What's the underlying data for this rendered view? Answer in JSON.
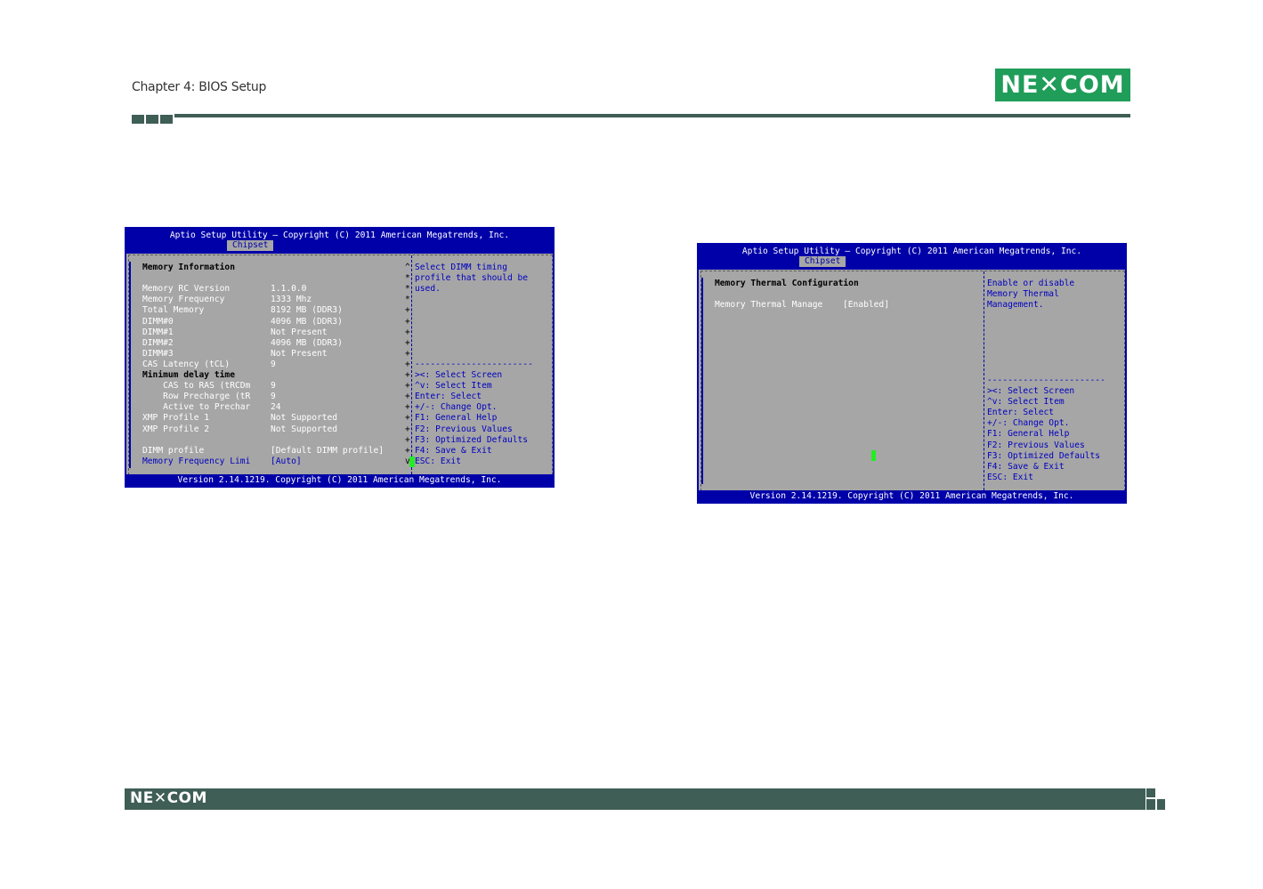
{
  "page": {
    "chapter_title": "Chapter 4: BIOS Setup",
    "logo_text": "NE✕COM",
    "footer_logo_text": "NE✕COM"
  },
  "bios_left": {
    "title": "Aptio Setup Utility – Copyright (C) 2011 American Megatrends, Inc.",
    "tab": "Chipset",
    "footer": "Version 2.14.1219. Copyright (C) 2011 American Megatrends, Inc.",
    "rows": [
      {
        "label": "Memory Information",
        "value": "",
        "style": "black"
      },
      {
        "label": "",
        "value": "",
        "style": "white"
      },
      {
        "label": "Memory RC Version",
        "value": "1.1.0.0",
        "style": "white"
      },
      {
        "label": "Memory Frequency",
        "value": "1333 Mhz",
        "style": "white"
      },
      {
        "label": "Total Memory",
        "value": "8192 MB (DDR3)",
        "style": "white"
      },
      {
        "label": "DIMM#0",
        "value": "4096 MB (DDR3)",
        "style": "white"
      },
      {
        "label": "DIMM#1",
        "value": "Not Present",
        "style": "white"
      },
      {
        "label": "DIMM#2",
        "value": "4096 MB (DDR3)",
        "style": "white"
      },
      {
        "label": "DIMM#3",
        "value": "Not Present",
        "style": "white"
      },
      {
        "label": "CAS Latency (tCL)",
        "value": "9",
        "style": "white"
      },
      {
        "label": "Minimum delay time",
        "value": "",
        "style": "black"
      },
      {
        "label": "    CAS to RAS (tRCDm",
        "value": "9",
        "style": "white"
      },
      {
        "label": "    Row Precharge (tR",
        "value": "9",
        "style": "white"
      },
      {
        "label": "    Active to Prechar",
        "value": "24",
        "style": "white"
      },
      {
        "label": "XMP Profile 1",
        "value": "Not Supported",
        "style": "white"
      },
      {
        "label": "XMP Profile 2",
        "value": "Not Supported",
        "style": "white"
      },
      {
        "label": "",
        "value": "",
        "style": "white"
      },
      {
        "label": "DIMM profile",
        "value": "[Default DIMM profile]",
        "style": "white"
      },
      {
        "label": "Memory Frequency Limi",
        "value": "[Auto]",
        "style": "blue"
      }
    ],
    "scroll_marks": [
      "^",
      "*",
      "*",
      "*",
      "+",
      "+",
      "+",
      "+",
      "+",
      "+",
      "+",
      "+",
      "+",
      "+",
      "+",
      "+",
      "+",
      "+",
      "v"
    ],
    "help_lines": [
      "Select DIMM timing",
      "profile that should be",
      "used.",
      "",
      "",
      "",
      "",
      "",
      "",
      "-----------------------",
      "><: Select Screen",
      "^v: Select Item",
      "Enter: Select",
      "+/-: Change Opt.",
      "F1: General Help",
      "F2: Previous Values",
      "F3: Optimized Defaults",
      "F4: Save & Exit",
      "ESC: Exit"
    ]
  },
  "bios_right": {
    "title": "Aptio Setup Utility – Copyright (C) 2011 American Megatrends, Inc.",
    "tab": "Chipset",
    "footer": "Version 2.14.1219. Copyright (C) 2011 American Megatrends, Inc.",
    "rows": [
      {
        "label": "Memory Thermal Configuration",
        "value": "",
        "style": "black"
      },
      {
        "label": "",
        "value": "",
        "style": "white"
      },
      {
        "label": "Memory Thermal Manage",
        "value": "[Enabled]",
        "style": "white"
      }
    ],
    "help_lines": [
      "Enable or disable",
      "Memory Thermal",
      "Management.",
      "",
      "",
      "",
      "",
      "",
      "",
      "-----------------------",
      "><: Select Screen",
      "^v: Select Item",
      "Enter: Select",
      "+/-: Change Opt.",
      "F1: General Help",
      "F2: Previous Values",
      "F3: Optimized Defaults",
      "F4: Save & Exit",
      "ESC: Exit"
    ]
  },
  "colors": {
    "bios_blue": "#0000a8",
    "bios_gray": "#a6a6a6",
    "brand_green": "#1f9d59",
    "rule_dark_green": "#3f5e55",
    "cursor_green": "#22ee22"
  }
}
